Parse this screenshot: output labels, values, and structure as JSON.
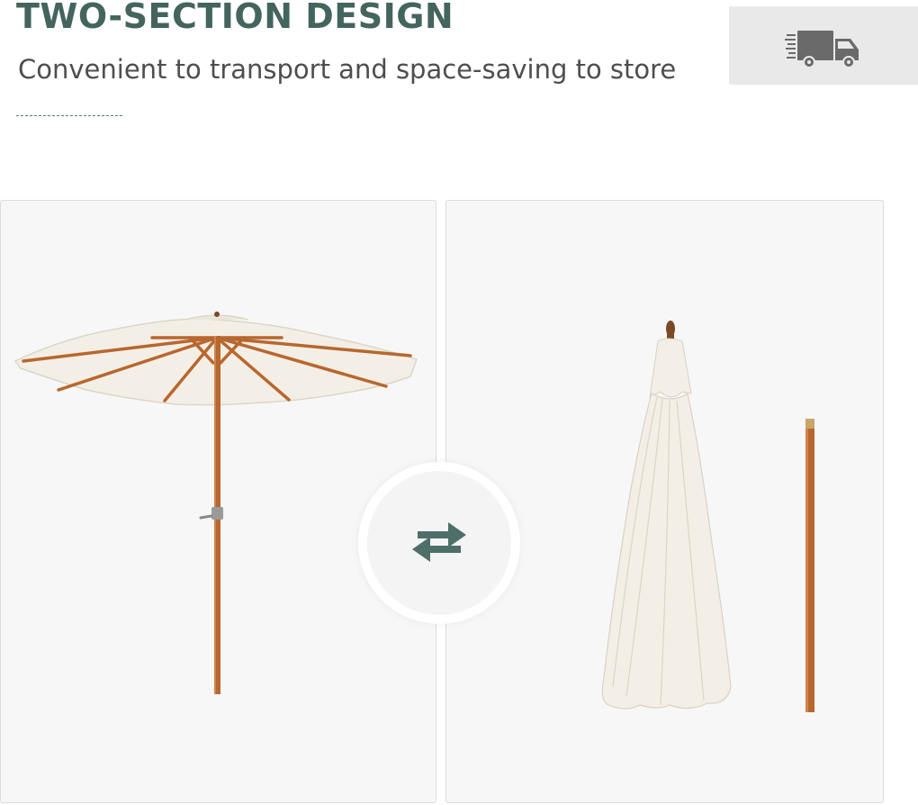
{
  "header": {
    "title": "TWO-SECTION DESIGN",
    "subtitle": "Convenient to transport and space-saving to store"
  },
  "badge": {
    "icon": "delivery-truck-icon"
  },
  "panels": [
    {
      "name": "open-umbrella",
      "icon": "open-umbrella-image"
    },
    {
      "name": "disassembled-umbrella",
      "icon": "folded-umbrella-and-pole-image"
    }
  ],
  "swap": {
    "icon": "swap-arrows-icon"
  },
  "colors": {
    "accent": "#44645e",
    "text": "#4e4e4e",
    "panel_bg": "#f7f7f7",
    "badge_bg": "#e9e9e9",
    "wood": "#b8672e",
    "canopy": "#f3efe6"
  }
}
